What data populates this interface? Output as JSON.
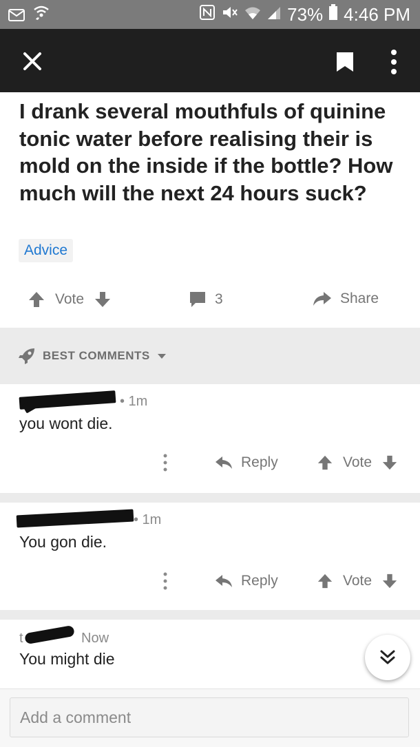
{
  "status_bar": {
    "battery": "73%",
    "time": "4:46 PM",
    "icons": [
      "gmail-icon",
      "wifi-calling-icon",
      "nfc-icon",
      "mute-icon",
      "wifi-icon",
      "signal-icon",
      "battery-icon"
    ]
  },
  "toolbar": {
    "icons": [
      "close-icon",
      "bookmark-icon",
      "more-vertical-icon"
    ]
  },
  "post": {
    "title": "I drank several mouthfuls of quinine tonic water before realising their is mold on the inside if the bottle? How much will the next 24 hours suck?",
    "tag": "Advice",
    "vote_label": "Vote",
    "comment_count": "3",
    "share_label": "Share"
  },
  "comments_header": {
    "label": "BEST COMMENTS"
  },
  "comments": [
    {
      "time": "• 1m",
      "body": "you wont die.",
      "reply": "Reply",
      "vote": "Vote"
    },
    {
      "time": "• 1m",
      "body": "You gon die.",
      "reply": "Reply",
      "vote": "Vote"
    },
    {
      "prefix": "t",
      "time": "Now",
      "body": "You might die"
    }
  ],
  "composer": {
    "placeholder": "Add a comment"
  },
  "colors": {
    "status_bar": "#7b7b7b",
    "toolbar": "#1f1f1f",
    "tag_text": "#1f78d1",
    "separator": "#ebebeb",
    "muted": "#767676"
  }
}
